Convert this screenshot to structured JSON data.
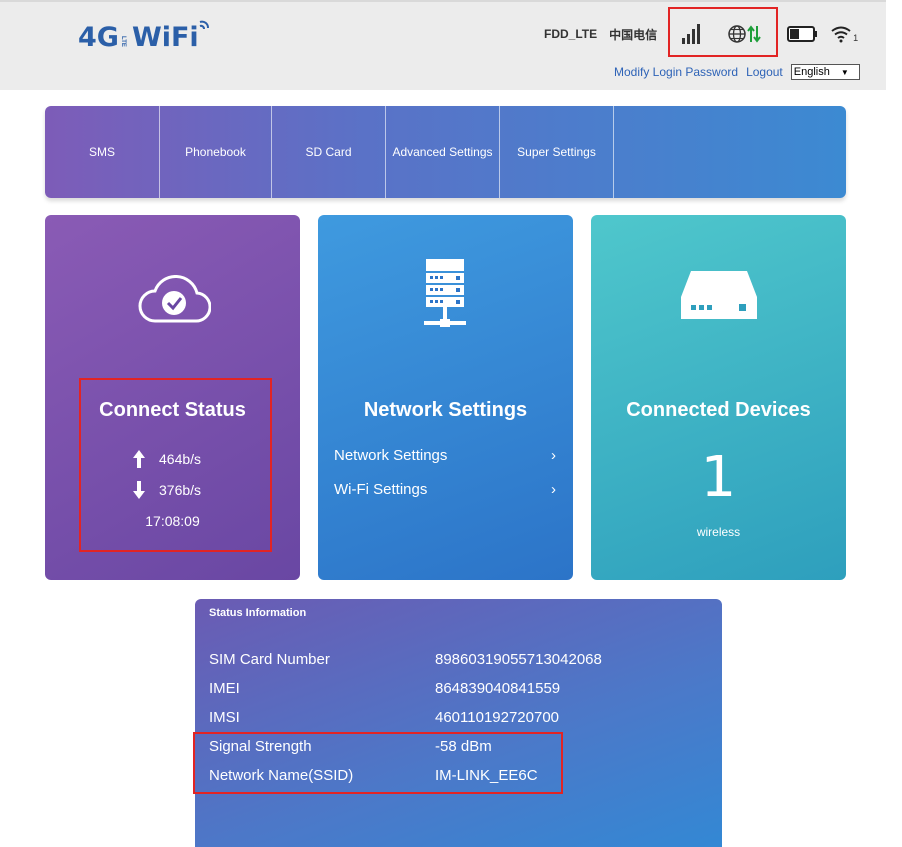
{
  "header": {
    "logo_main": "4G",
    "logo_lte": "LTE",
    "logo_wifi": "WiFi",
    "network_type": "FDD_LTE",
    "carrier": "中国电信",
    "signal_bars": 4,
    "wifi_clients": "1",
    "modify_password": "Modify Login Password",
    "logout": "Logout",
    "language": "English",
    "language_options": [
      "English"
    ]
  },
  "nav": {
    "items": [
      "SMS",
      "Phonebook",
      "SD Card",
      "Advanced Settings",
      "Super Settings"
    ]
  },
  "connect_status": {
    "title": "Connect Status",
    "upload": "464b/s",
    "download": "376b/s",
    "time": "17:08:09"
  },
  "network_settings": {
    "title": "Network Settings",
    "links": [
      "Network Settings",
      "Wi-Fi Settings"
    ],
    "chevron": "›"
  },
  "connected_devices": {
    "title": "Connected Devices",
    "count": "1",
    "label": "wireless"
  },
  "status_information": {
    "title": "Status Information",
    "rows": [
      {
        "key": "SIM Card Number",
        "value": "89860319055713042068"
      },
      {
        "key": "IMEI",
        "value": "864839040841559"
      },
      {
        "key": "IMSI",
        "value": "460110192720700"
      },
      {
        "key": "Signal Strength",
        "value": "-58 dBm"
      },
      {
        "key": "Network Name(SSID)",
        "value": "IM-LINK_EE6C"
      }
    ]
  },
  "colors": {
    "highlight": "#e22424",
    "link": "#2e63b7",
    "data_arrows": "#1e9e3a"
  }
}
